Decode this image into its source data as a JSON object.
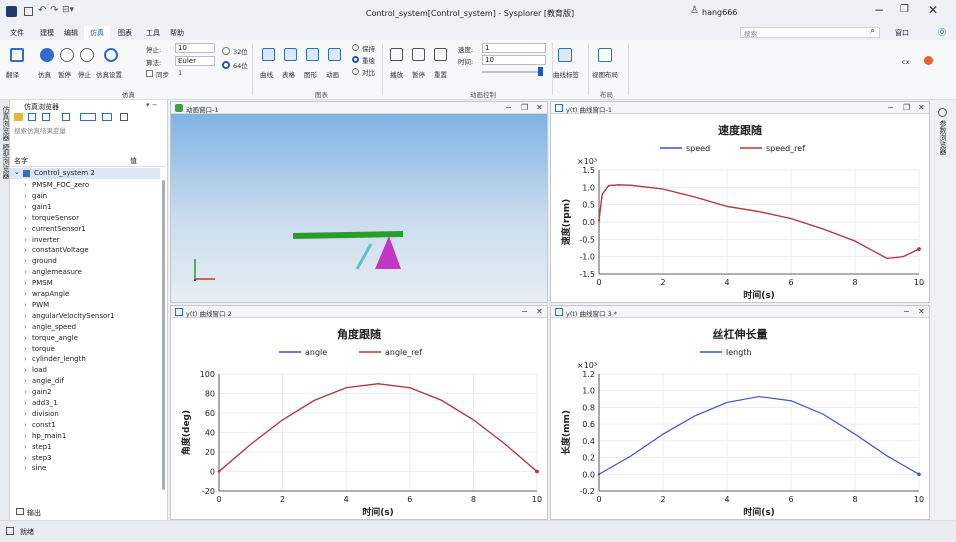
{
  "app": {
    "title": "Control_system[Control_system] - Sysplorer [教育版]",
    "user": "hang666",
    "search_placeholder": "搜索",
    "window_label": "窗口"
  },
  "menu": [
    "文件",
    "建模",
    "编辑",
    "仿真",
    "图表",
    "工具",
    "帮助"
  ],
  "ribbon": {
    "sim_buttons": [
      "翻译",
      "仿真",
      "暂停",
      "停止",
      "仿真设置"
    ],
    "stop_time_label": "停止:",
    "stop_time": "10",
    "algo_label": "算法:",
    "algo": "Euler",
    "sync_label": "同步",
    "sync_value": "1",
    "bits32": "32位",
    "bits64": "64位",
    "chart_buttons": [
      "曲线",
      "表格",
      "图形",
      "动画"
    ],
    "keep_label": "保持",
    "overlay_label": "重绘",
    "compare_label": "对比",
    "anim_buttons": [
      "播放",
      "暂停",
      "重置"
    ],
    "speed_label": "速度:",
    "speed_value": "1",
    "time_label": "时间:",
    "time_value": "10",
    "monitor_button": "曲线标签",
    "layout_button": "视图布局",
    "group_sim": "仿真",
    "group_chart": "图表",
    "group_anim": "动画控制",
    "group_layout": "布局",
    "right_label": "cx"
  },
  "left_panel": {
    "title": "仿真浏览器",
    "search_placeholder": "搜索仿真结果变量",
    "col_name": "名字",
    "col_value": "值",
    "root": "Control_system 2",
    "items": [
      "PMSM_FOC_zero",
      "gain",
      "gain1",
      "torqueSensor",
      "currentSensor1",
      "inverter",
      "constantVoltage",
      "ground",
      "anglemeasure",
      "PMSM",
      "wrapAngle",
      "PWM",
      "angularVelocitySensor1",
      "angle_speed",
      "torque_angle",
      "torque",
      "cylinder_length",
      "load",
      "angle_dif",
      "gain2",
      "add3_1",
      "division",
      "const1",
      "hp_main1",
      "step1",
      "step3",
      "sine"
    ],
    "bottom_tab": "输出",
    "side_tab1": "模型浏览器",
    "side_tab2": "仿真浏览器"
  },
  "right_tab": "参数浏览器",
  "status": {
    "text": "就绪"
  },
  "windows": {
    "anim": {
      "title": "动画窗口-1"
    },
    "w1": {
      "title": "y(t) 曲线窗口-1"
    },
    "w2": {
      "title": "y(t) 曲线窗口 2"
    },
    "w3": {
      "title": "y(t) 曲线窗口 3 *"
    }
  },
  "chart_data": [
    {
      "type": "line",
      "title": "速度跟随",
      "xlabel": "时间(s)",
      "ylabel": "速度(rpm)",
      "y_multiplier": "×10³",
      "xlim": [
        0,
        10
      ],
      "ylim": [
        -1.5,
        1.5
      ],
      "xticks": [
        0,
        2,
        4,
        6,
        8,
        10
      ],
      "yticks": [
        -1.5,
        -1.0,
        -0.5,
        0.0,
        0.5,
        1.0,
        1.5
      ],
      "legend": [
        "speed",
        "speed_ref"
      ],
      "series": [
        {
          "name": "speed",
          "color": "#3b4fd8",
          "x": [
            0,
            0.1,
            0.3,
            0.6,
            1,
            2,
            3,
            4,
            5,
            6,
            7,
            8,
            8.5,
            9,
            9.5,
            10
          ],
          "y": [
            0.05,
            0.8,
            1.05,
            1.07,
            1.06,
            0.95,
            0.72,
            0.45,
            0.3,
            0.1,
            -0.2,
            -0.55,
            -0.8,
            -1.05,
            -1.0,
            -0.78
          ]
        },
        {
          "name": "speed_ref",
          "color": "#c8322c",
          "x": [
            0,
            0.1,
            0.3,
            0.6,
            1,
            2,
            3,
            4,
            5,
            6,
            7,
            8,
            8.5,
            9,
            9.5,
            10
          ],
          "y": [
            0.05,
            0.8,
            1.05,
            1.07,
            1.06,
            0.95,
            0.72,
            0.45,
            0.3,
            0.1,
            -0.2,
            -0.55,
            -0.8,
            -1.05,
            -1.0,
            -0.78
          ]
        }
      ]
    },
    {
      "type": "line",
      "title": "角度跟随",
      "xlabel": "时间(s)",
      "ylabel": "角度(deg)",
      "xlim": [
        0,
        10
      ],
      "ylim": [
        -20,
        100
      ],
      "xticks": [
        0,
        2,
        4,
        6,
        8,
        10
      ],
      "yticks": [
        -20,
        0,
        20,
        40,
        60,
        80,
        100
      ],
      "legend": [
        "angle",
        "angle_ref"
      ],
      "series": [
        {
          "name": "angle",
          "color": "#3b4fd8",
          "x": [
            0,
            1,
            2,
            3,
            4,
            5,
            6,
            7,
            8,
            9,
            10
          ],
          "y": [
            0,
            28,
            53,
            73,
            86,
            90,
            86,
            73,
            53,
            28,
            0
          ]
        },
        {
          "name": "angle_ref",
          "color": "#c8322c",
          "x": [
            0,
            1,
            2,
            3,
            4,
            5,
            6,
            7,
            8,
            9,
            10
          ],
          "y": [
            0,
            28,
            53,
            73,
            86,
            90,
            86,
            73,
            53,
            28,
            0
          ]
        }
      ]
    },
    {
      "type": "line",
      "title": "丝杠伸长量",
      "xlabel": "时间(s)",
      "ylabel": "长度(mm)",
      "y_multiplier": "×10³",
      "xlim": [
        0,
        10
      ],
      "ylim": [
        -0.2,
        1.2
      ],
      "xticks": [
        0,
        2,
        4,
        6,
        8,
        10
      ],
      "yticks": [
        -0.2,
        0.0,
        0.2,
        0.4,
        0.6,
        0.8,
        1.0,
        1.2
      ],
      "legend": [
        "length"
      ],
      "series": [
        {
          "name": "length",
          "color": "#3b4fd8",
          "x": [
            0,
            1,
            2,
            3,
            4,
            5,
            6,
            7,
            8,
            9,
            10
          ],
          "y": [
            0,
            0.22,
            0.48,
            0.7,
            0.86,
            0.93,
            0.88,
            0.72,
            0.48,
            0.22,
            0
          ]
        }
      ]
    }
  ]
}
